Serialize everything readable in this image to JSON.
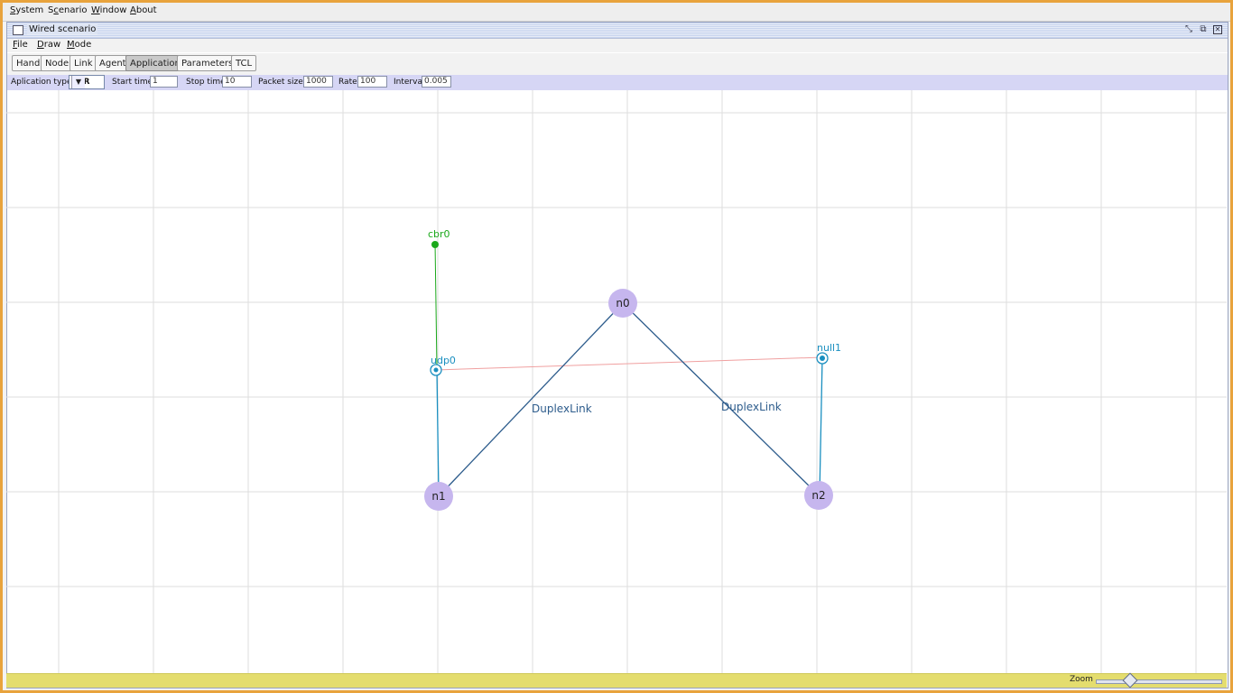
{
  "system_menu": {
    "items": [
      {
        "label": "System",
        "mnemonic": "S",
        "rest": "ystem"
      },
      {
        "label": "Scenario",
        "mnemonic": "c",
        "rest": "enario",
        "pre": "S"
      },
      {
        "label": "Window",
        "mnemonic": "W",
        "rest": "indow"
      },
      {
        "label": "About",
        "mnemonic": "A",
        "rest": "bout"
      }
    ]
  },
  "window": {
    "title": "Wired scenario",
    "buttons": [
      "minimize-icon",
      "restore-icon",
      "close-icon"
    ]
  },
  "menubar": {
    "file": "File",
    "draw": "Draw",
    "mode": "Mode"
  },
  "toolbar": {
    "hand": "Hand",
    "node": "Node",
    "link": "Link",
    "agent": "Agent",
    "application": "Application",
    "parameters": "Parameters",
    "tcl": "TCL",
    "active": "Application"
  },
  "params": {
    "application_type_label": "Aplication type",
    "application_type_value": "CBR",
    "start_time_label": "Start time",
    "start_time_value": "1",
    "stop_time_label": "Stop time",
    "stop_time_value": "10",
    "packet_size_label": "Packet size",
    "packet_size_value": "1000",
    "rate_label": "Rate",
    "rate_value": "100",
    "interval_label": "Interval",
    "interval_value": "0.005"
  },
  "topology": {
    "nodes": [
      "n0",
      "n1",
      "n2"
    ],
    "links": [
      {
        "label": "DuplexLink",
        "from": "n1",
        "to": "n0"
      },
      {
        "label": "DuplexLink",
        "from": "n0",
        "to": "n2"
      }
    ],
    "agents": [
      {
        "label": "udp0",
        "attached_to": "n1"
      },
      {
        "label": "null1",
        "attached_to": "n2"
      }
    ],
    "applications": [
      {
        "label": "cbr0",
        "attached_to": "udp0"
      }
    ],
    "colors": {
      "node_fill": "#c6b6ee",
      "link": "#2d5c8c",
      "agent": "#1a8fc0",
      "application": "#1aa81a",
      "connection": "#f0a0a0",
      "grid": "#dedede"
    }
  },
  "statusbar": {
    "zoom_label": "Zoom",
    "zoom_level": 0.27
  }
}
